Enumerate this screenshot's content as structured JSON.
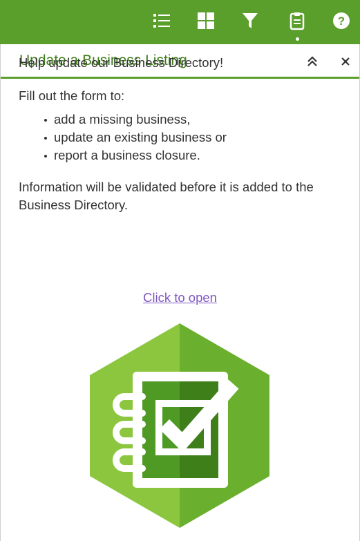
{
  "toolbar": {
    "icons": [
      "list-icon",
      "grid-icon",
      "filter-icon",
      "clipboard-icon",
      "help-icon"
    ],
    "color": "#5a9e2b"
  },
  "panel": {
    "title": "Update a Business Listing",
    "collapse_icon": "double-chevron-up-icon",
    "close_icon": "close-icon"
  },
  "content": {
    "intro": "Help update our Business Directory!",
    "fill_out": "Fill out the form to:",
    "items": [
      "add a missing business,",
      "update an existing business or",
      "report a business closure."
    ],
    "note": "Information will be validated before it is added to the Business Directory.",
    "link_text": "Click to open"
  },
  "logo": {
    "name": "survey123-logo",
    "colors": [
      "#8cc63f",
      "#5a9e2b",
      "#3f7f1a"
    ]
  }
}
